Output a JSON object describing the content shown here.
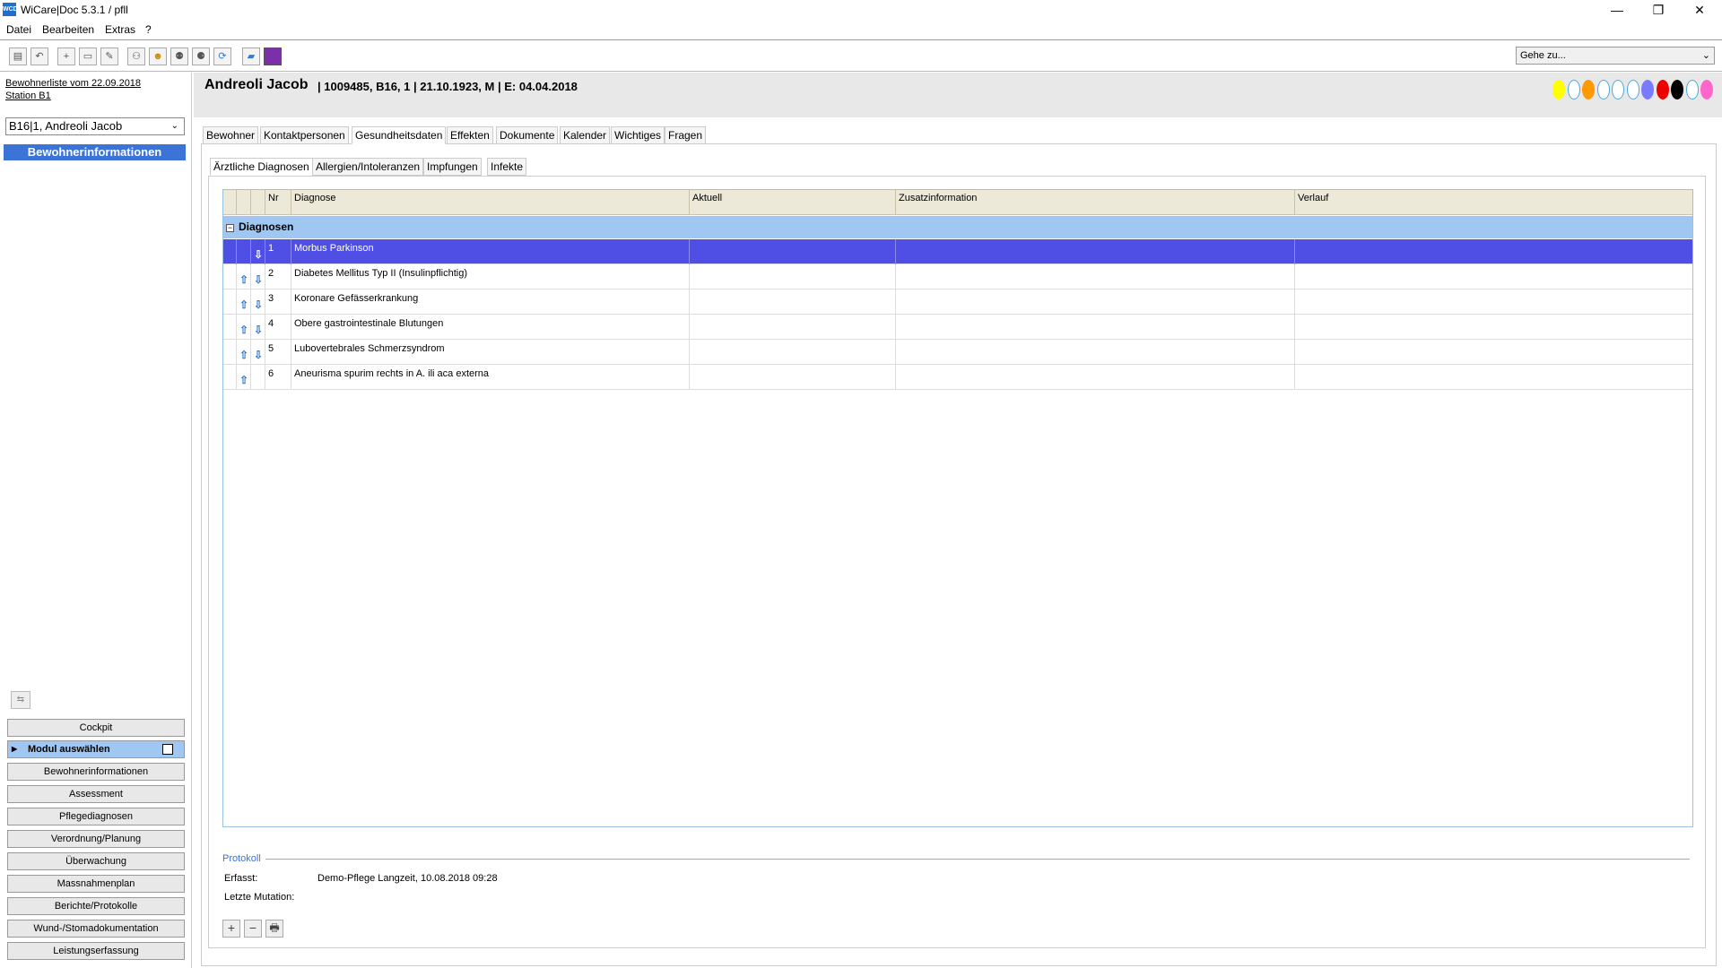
{
  "window": {
    "title": "WiCare|Doc 5.3.1  / pfll",
    "icon_text": "WCD",
    "minimize": "—",
    "restore": "❐",
    "close": "✕"
  },
  "menu": {
    "datei": "Datei",
    "bearbeiten": "Bearbeiten",
    "extras": "Extras",
    "help": "?"
  },
  "toolbar": {
    "goto_value": "Gehe zu..."
  },
  "left": {
    "resident_list": "Bewohnerliste vom 22.09.2018",
    "station": "Station B1",
    "resident_select": "B16|1, Andreoli Jacob",
    "header": "Bewohnerinformationen",
    "modules": [
      "Cockpit",
      "Modul auswählen",
      "Bewohnerinformationen",
      "Assessment",
      "Pflegediagnosen",
      "Verordnung/Planung",
      "Überwachung",
      "Massnahmenplan",
      "Berichte/Protokolle",
      "Wund-/Stomadokumentation",
      "Leistungserfassung"
    ]
  },
  "patient": {
    "name": "Andreoli Jacob",
    "info": "| 1009485, B16, 1 | 21.10.1923, M | E: 04.04.2018",
    "colors": [
      "#ffff00",
      "#ffffff",
      "#ff9900",
      "#ffffff",
      "#ffffff",
      "#ffffff",
      "#7a7aff",
      "#ee0000",
      "#000000",
      "#ffffff",
      "#ff66cc"
    ]
  },
  "tabs_main": [
    "Bewohner",
    "Kontaktpersonen",
    "Gesundheitsdaten",
    "Effekten",
    "Dokumente",
    "Kalender",
    "Wichtiges",
    "Fragen"
  ],
  "tabs_sub": [
    "Ärztliche Diagnosen",
    "Allergien/Intoleranzen",
    "Impfungen",
    "Infekte"
  ],
  "grid": {
    "headers": {
      "nr": "Nr",
      "diagnose": "Diagnose",
      "aktuell": "Aktuell",
      "zusatz": "Zusatzinformation",
      "verlauf": "Verlauf"
    },
    "group": "Diagnosen",
    "rows": [
      {
        "nr": "1",
        "diagnose": "Morbus Parkinson",
        "up": false,
        "down": true
      },
      {
        "nr": "2",
        "diagnose": "Diabetes Mellitus Typ II (Insulinpflichtig)",
        "up": true,
        "down": true
      },
      {
        "nr": "3",
        "diagnose": "Koronare Gefässerkrankung",
        "up": true,
        "down": true
      },
      {
        "nr": "4",
        "diagnose": "Obere gastrointestinale Blutungen",
        "up": true,
        "down": true
      },
      {
        "nr": "5",
        "diagnose": "Lubovertebrales Schmerzsyndrom",
        "up": true,
        "down": true
      },
      {
        "nr": "6",
        "diagnose": "Aneurisma spurim rechts in A. ili aca externa",
        "up": true,
        "down": false
      }
    ]
  },
  "protokoll": {
    "label": "Protokoll",
    "erfasst_label": "Erfasst:",
    "erfasst_value": "Demo-Pflege Langzeit, 10.08.2018 09:28",
    "mutation_label": "Letzte Mutation:",
    "mutation_value": ""
  },
  "buttons": {
    "add": "+",
    "remove": "−",
    "print": "🖶"
  }
}
